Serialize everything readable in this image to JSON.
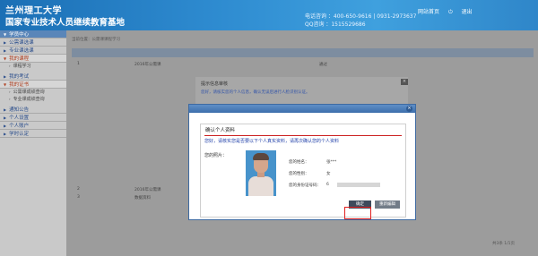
{
  "header": {
    "title_line1": "兰州理工大学",
    "title_line2": "国家专业技术人员继续教育基地",
    "phone": "电话咨询 ：400-650-9616 | 0931-2973637",
    "qq": "QQ咨询 ：1515529686",
    "nav": [
      "网站首页",
      "退出"
    ]
  },
  "sidebar": {
    "items": [
      {
        "label": "学员中心",
        "type": "head"
      },
      {
        "label": "公需课选课",
        "type": "item"
      },
      {
        "label": "专业课选课",
        "type": "item"
      },
      {
        "label": "我的课程",
        "type": "open"
      },
      {
        "label": "课程学习",
        "type": "sub"
      },
      {
        "label": "我的考试",
        "type": "item"
      },
      {
        "label": "我的证书",
        "type": "open"
      },
      {
        "label": "公需课成绩查询",
        "type": "sub"
      },
      {
        "label": "专业课成绩查询",
        "type": "sub"
      },
      {
        "label": "通知公告",
        "type": "item"
      },
      {
        "label": "个人设置",
        "type": "item"
      },
      {
        "label": "个人账户",
        "type": "item"
      },
      {
        "label": "学时认定",
        "type": "item"
      }
    ]
  },
  "background": {
    "breadcrumb": "当前位置：公需课课程学习",
    "rows": [
      {
        "no": "1",
        "name": "2016年公需课",
        "status": "通过"
      },
      {
        "no": "2",
        "name": "2016年公需课",
        "status": "通过"
      },
      {
        "no": "3",
        "name": "数据资料",
        "status": "通过"
      }
    ],
    "panel_title": "提示信息审核",
    "panel_note": "您好，请核实您的个人信息，确认无误后进行人脸识别认证。",
    "pager": "共3条  1/1页"
  },
  "modal": {
    "title": "确认个人资料",
    "notice": "您好，请核实您是否要以下个人真实资料，请再次确认您的个人资料",
    "photo_label": "您的照片：",
    "fields": [
      {
        "label": "您的姓名：",
        "value": "张***"
      },
      {
        "label": "您的性别：",
        "value": "女"
      },
      {
        "label": "您的身份证号码：",
        "value": "6"
      }
    ],
    "confirm_label": "确定",
    "rescan_label": "重新编辑"
  },
  "colors": {
    "header": "#2e8bd0",
    "modal_bar": "#3d6fab",
    "highlight_ring": "#e02020",
    "notice_text": "#1f3fa8"
  }
}
